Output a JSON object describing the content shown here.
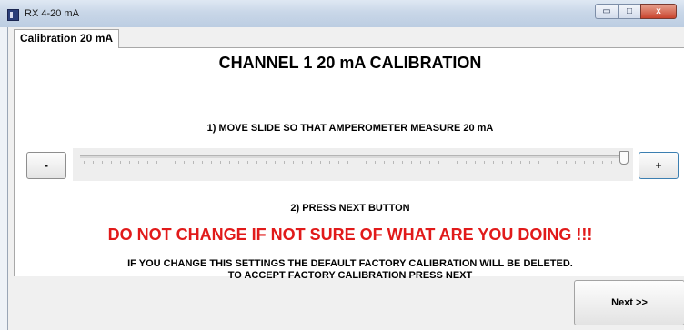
{
  "window": {
    "title": "RX 4-20 mA",
    "icon": "app-icon"
  },
  "window_controls": {
    "minimize": "▭",
    "maximize": "□",
    "close": "x"
  },
  "tabs": [
    {
      "label": "Calibration 20 mA",
      "active": true
    }
  ],
  "main": {
    "heading": "CHANNEL 1 20 mA CALIBRATION",
    "step1": "1) MOVE SLIDE SO THAT AMPEROMETER  MEASURE 20 mA",
    "step2": "2) PRESS NEXT BUTTON",
    "warning": "DO NOT CHANGE IF NOT SURE OF WHAT ARE YOU DOING !!!",
    "note_line1": "IF YOU CHANGE THIS SETTINGS THE DEFAULT FACTORY CALIBRATION WILL BE DELETED.",
    "note_line2": "TO ACCEPT FACTORY CALIBRATION PRESS NEXT"
  },
  "slider": {
    "minus_label": "-",
    "plus_label": "+",
    "value_fraction": 1.0
  },
  "footer": {
    "next_label": "Next >>"
  },
  "colors": {
    "warning": "#e11a1a",
    "titlebar": "#c9d7e8",
    "accent_border": "#3c7fb1"
  }
}
